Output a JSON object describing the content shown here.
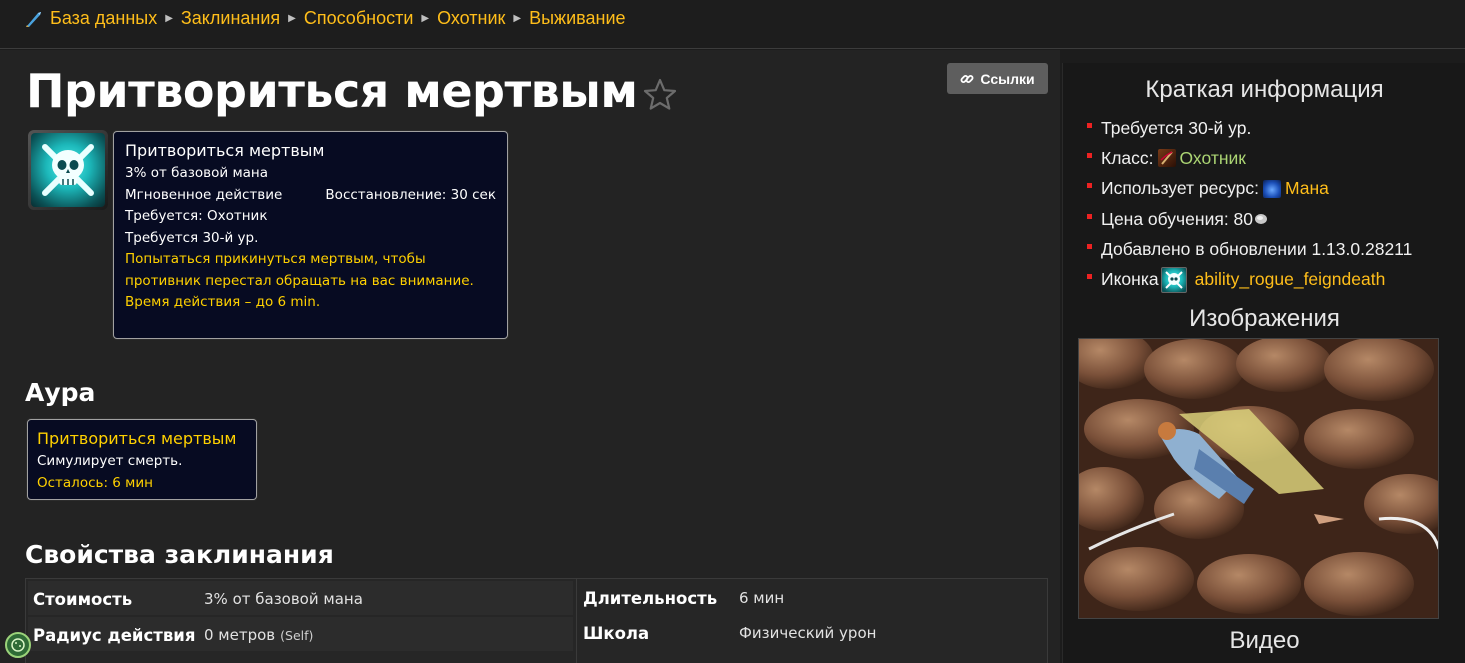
{
  "breadcrumb": {
    "items": [
      "База данных",
      "Заклинания",
      "Способности",
      "Охотник",
      "Выживание"
    ]
  },
  "page": {
    "title": "Притвориться мертвым",
    "links_button": "Ссылки"
  },
  "tooltip": {
    "title": "Притвориться мертвым",
    "cost": "3% от базовой мана",
    "cast_time": "Мгновенное действие",
    "cooldown": "Восстановление: 30 сек",
    "requires_class": "Требуется: Охотник",
    "requires_level": "Требуется 30-й ур.",
    "description": "Попытаться прикинуться мертвым, чтобы противник перестал обращать на вас внимание.",
    "duration": "Время действия – до 6 min."
  },
  "aura": {
    "heading": "Аура",
    "title": "Притвориться мертвым",
    "description": "Симулирует смерть.",
    "remaining": "Осталось: 6 мин"
  },
  "properties": {
    "heading": "Свойства заклинания",
    "left": [
      {
        "key": "Стоимость",
        "value": "3% от базовой мана",
        "note": ""
      },
      {
        "key": "Радиус действия",
        "value": "0 метров",
        "note": "(Self)"
      }
    ],
    "right": [
      {
        "key": "Длительность",
        "value": "6 мин"
      },
      {
        "key": "Школа",
        "value": "Физический урон"
      }
    ]
  },
  "sidebar": {
    "quick_info_title": "Краткая информация",
    "items": {
      "level": "Требуется 30-й ур.",
      "class_label": "Класс:",
      "class_value": "Охотник",
      "resource_label": "Использует ресурс:",
      "resource_value": "Мана",
      "training_cost": "Цена обучения: 80",
      "added_in": "Добавлено в обновлении 1.13.0.28211",
      "icon_label": "Иконка",
      "icon_value": "ability_rogue_feigndeath"
    },
    "images_title": "Изображения",
    "video_title": "Видео"
  },
  "colors": {
    "link": "#ffbe1a",
    "tooltip_yellow": "#ffd100",
    "class_hunter": "#abd473",
    "bullet": "#ee2222"
  },
  "icons": [
    "database-icon",
    "star-icon",
    "link-icon",
    "feign-death-icon",
    "hunter-class-icon",
    "mana-icon",
    "silver-coin-icon",
    "cookie-icon"
  ]
}
